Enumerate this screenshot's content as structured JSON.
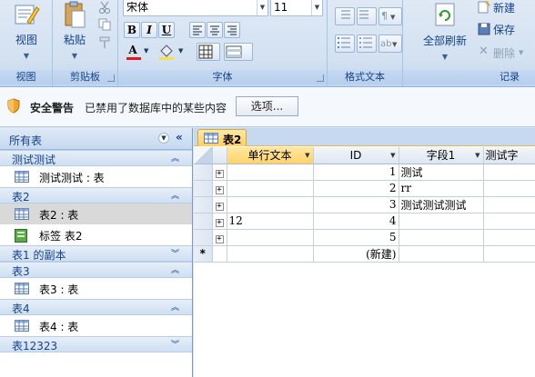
{
  "ribbon": {
    "groups": {
      "views": {
        "label": "视图",
        "view_button": "视图"
      },
      "clipboard": {
        "label": "剪贴板",
        "paste_button": "粘贴"
      },
      "font": {
        "label": "字体",
        "font_name": "宋体",
        "font_size": "11",
        "bold": "B",
        "italic": "I",
        "underline": "U"
      },
      "rich_text": {
        "label": "格式文本"
      },
      "records": {
        "label": "记录",
        "refresh_all": "全部刷新",
        "new": "新建",
        "save": "保存",
        "delete": "删除"
      }
    }
  },
  "security_bar": {
    "title": "安全警告",
    "message": "已禁用了数据库中的某些内容",
    "options_button": "选项..."
  },
  "nav_pane": {
    "header": "所有表",
    "groups": [
      {
        "name": "测试测试",
        "items": [
          {
            "label": "测试测试 : 表",
            "type": "table"
          }
        ]
      },
      {
        "name": "表2",
        "items": [
          {
            "label": "表2 : 表",
            "type": "table",
            "selected": true
          },
          {
            "label": "标签 表2",
            "type": "report"
          }
        ]
      },
      {
        "name": "表1 的副本",
        "items": []
      },
      {
        "name": "表3",
        "items": [
          {
            "label": "表3 : 表",
            "type": "table"
          }
        ]
      },
      {
        "name": "表4",
        "items": [
          {
            "label": "表4 : 表",
            "type": "table"
          }
        ]
      },
      {
        "name": "表12323",
        "items": []
      }
    ]
  },
  "document": {
    "tab_title": "表2",
    "columns": [
      "单行文本",
      "ID",
      "字段1",
      "测试字"
    ],
    "rows": [
      {
        "c1": "",
        "id": "1",
        "f1": "测试"
      },
      {
        "c1": "",
        "id": "2",
        "f1": "rr"
      },
      {
        "c1": "",
        "id": "3",
        "f1": "测试测试测试"
      },
      {
        "c1": "12",
        "id": "4",
        "f1": ""
      },
      {
        "c1": "",
        "id": "5",
        "f1": ""
      }
    ],
    "new_row_marker": "*",
    "new_row_label": "(新建)"
  }
}
